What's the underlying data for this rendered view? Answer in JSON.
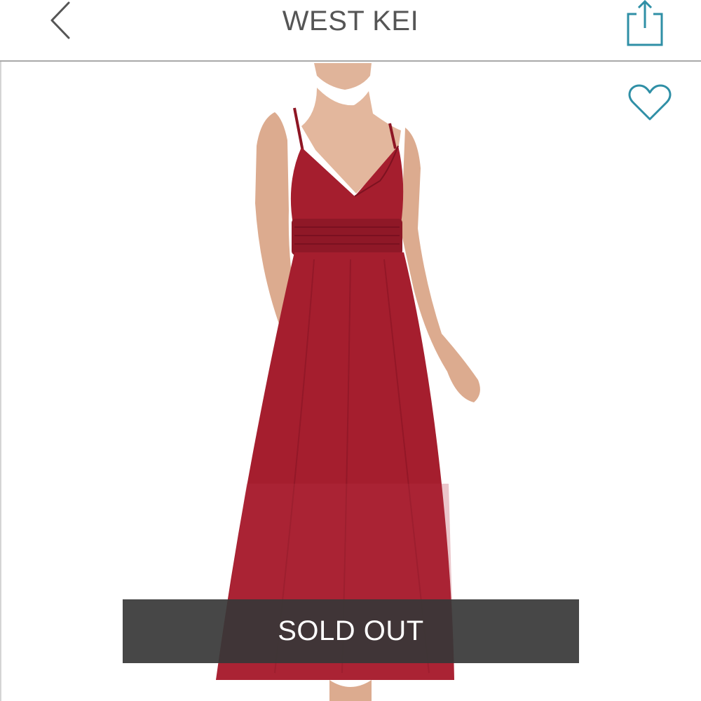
{
  "header": {
    "title": "WEST KEI",
    "back_icon": "chevron-left-icon",
    "share_icon": "share-icon"
  },
  "product": {
    "image": "red-sleeveless-maxi-dress-on-model",
    "favorite_icon": "heart-outline-icon",
    "status_label": "SOLD OUT"
  },
  "colors": {
    "accent": "#2f8fa6",
    "dress": "#a51e2e",
    "banner": "#3a3a3a",
    "header_text": "#555555"
  }
}
